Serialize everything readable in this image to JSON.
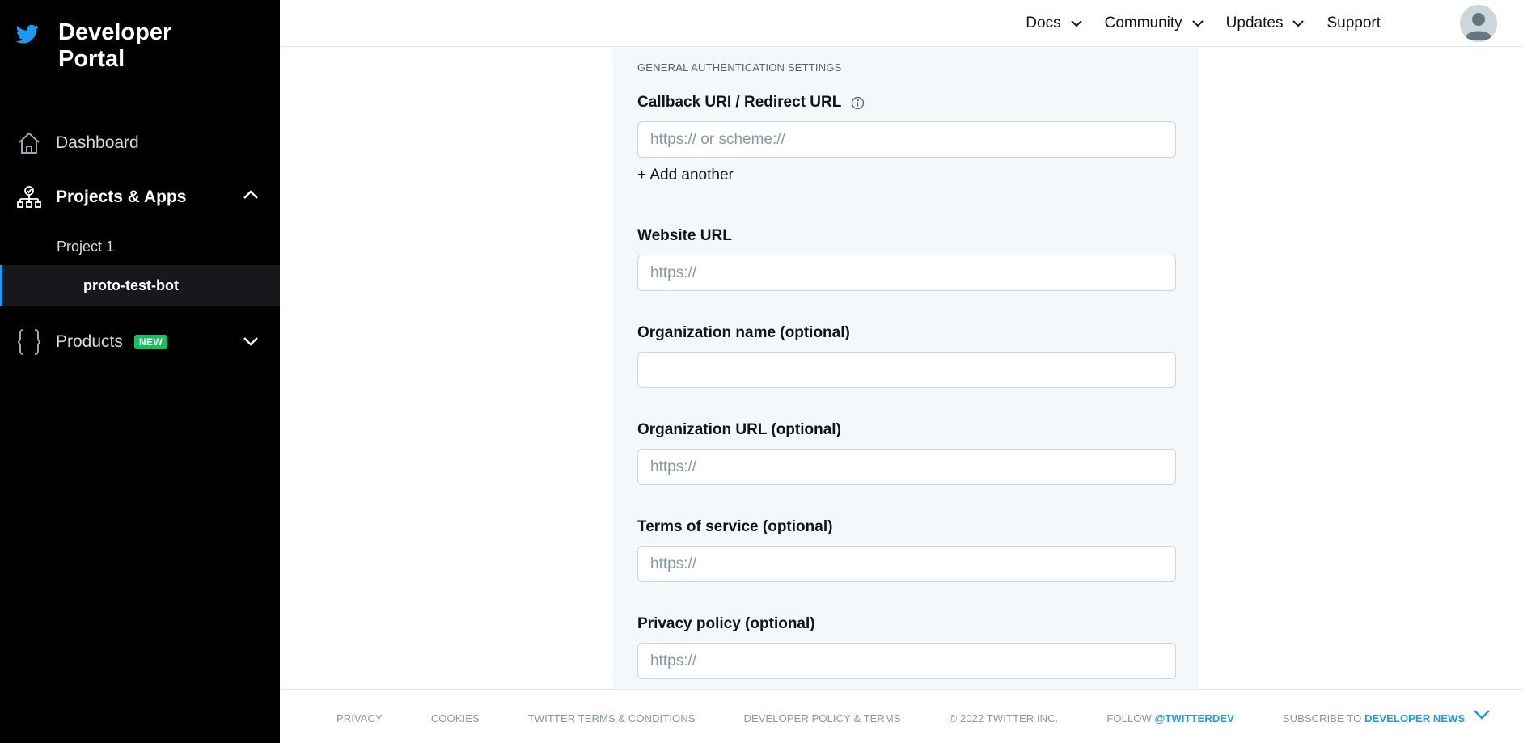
{
  "brand": {
    "title_line1": "Developer",
    "title_line2": "Portal"
  },
  "sidebar": {
    "dashboard": "Dashboard",
    "projects_apps": "Projects & Apps",
    "project1": "Project 1",
    "app": "proto-test-bot",
    "products": "Products",
    "products_badge": "NEW"
  },
  "topnav": {
    "docs": "Docs",
    "community": "Community",
    "updates": "Updates",
    "support": "Support"
  },
  "form": {
    "section_title": "GENERAL AUTHENTICATION SETTINGS",
    "callback_label": "Callback URI / Redirect URL",
    "callback_placeholder": "https:// or scheme://",
    "add_another": "+ Add another",
    "website_label": "Website URL",
    "website_placeholder": "https://",
    "org_name_label": "Organization name (optional)",
    "org_name_value": "",
    "org_url_label": "Organization URL (optional)",
    "org_url_placeholder": "https://",
    "tos_label": "Terms of service (optional)",
    "tos_placeholder": "https://",
    "privacy_label": "Privacy policy (optional)",
    "privacy_placeholder": "https://"
  },
  "footer": {
    "privacy": "PRIVACY",
    "cookies": "COOKIES",
    "terms": "TWITTER TERMS & CONDITIONS",
    "dev_policy": "DEVELOPER POLICY & TERMS",
    "copyright": "© 2022 TWITTER INC.",
    "follow": "FOLLOW",
    "follow_handle": "@TWITTERDEV",
    "subscribe": "SUBSCRIBE TO",
    "subscribe_link": "DEVELOPER NEWS"
  },
  "colors": {
    "accent": "#1d9bf0",
    "badge": "#17bf63",
    "sidebar_bg": "#000000",
    "panel_bg": "#f5f8fa"
  }
}
